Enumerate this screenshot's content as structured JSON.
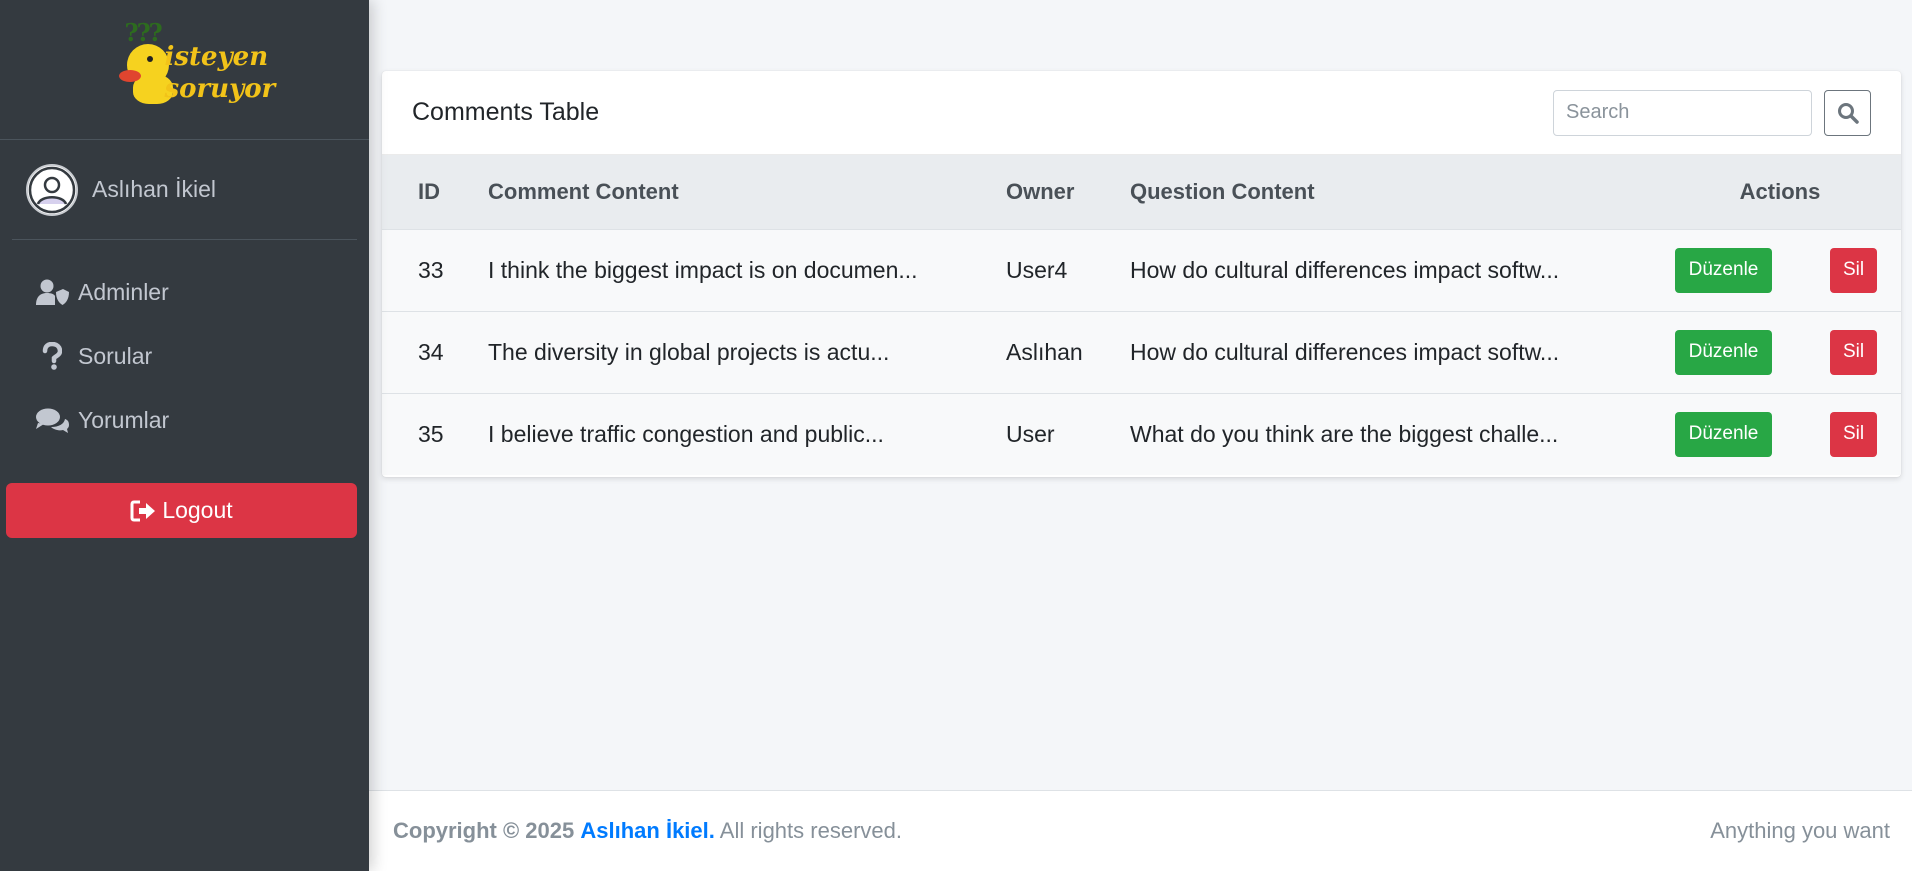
{
  "brand": {
    "line1": "isteyen",
    "line2": "soruyor",
    "marks": "???"
  },
  "user": {
    "name": "Aslıhan İkiel",
    "avatar_icon": "user-circle-icon"
  },
  "nav": {
    "items": [
      {
        "label": "Adminler",
        "icon": "user-shield-icon"
      },
      {
        "label": "Sorular",
        "icon": "question-icon"
      },
      {
        "label": "Yorumlar",
        "icon": "comments-icon"
      }
    ],
    "logout_label": "Logout"
  },
  "card": {
    "title": "Comments Table",
    "search_placeholder": "Search",
    "columns": {
      "id": "ID",
      "comment": "Comment Content",
      "owner": "Owner",
      "question": "Question Content",
      "actions": "Actions"
    },
    "edit_label": "Düzenle",
    "delete_label": "Sil",
    "rows": [
      {
        "id": "33",
        "comment": "I think the biggest impact is on documen...",
        "owner": "User4",
        "question": "How do cultural differences impact softw..."
      },
      {
        "id": "34",
        "comment": "The diversity in global projects is actu...",
        "owner": "Aslıhan",
        "question": "How do cultural differences impact softw..."
      },
      {
        "id": "35",
        "comment": "I believe traffic congestion and public...",
        "owner": "User",
        "question": "What do you think are the biggest challe..."
      }
    ]
  },
  "footer": {
    "copyright_prefix": "Copyright © 2025",
    "author": "Aslıhan İkiel.",
    "suffix": "All rights reserved.",
    "right": "Anything you want"
  },
  "colors": {
    "sidebar": "#343a40",
    "danger": "#dc3545",
    "success": "#28a745",
    "link": "#007bff",
    "background": "#f4f6f9"
  }
}
